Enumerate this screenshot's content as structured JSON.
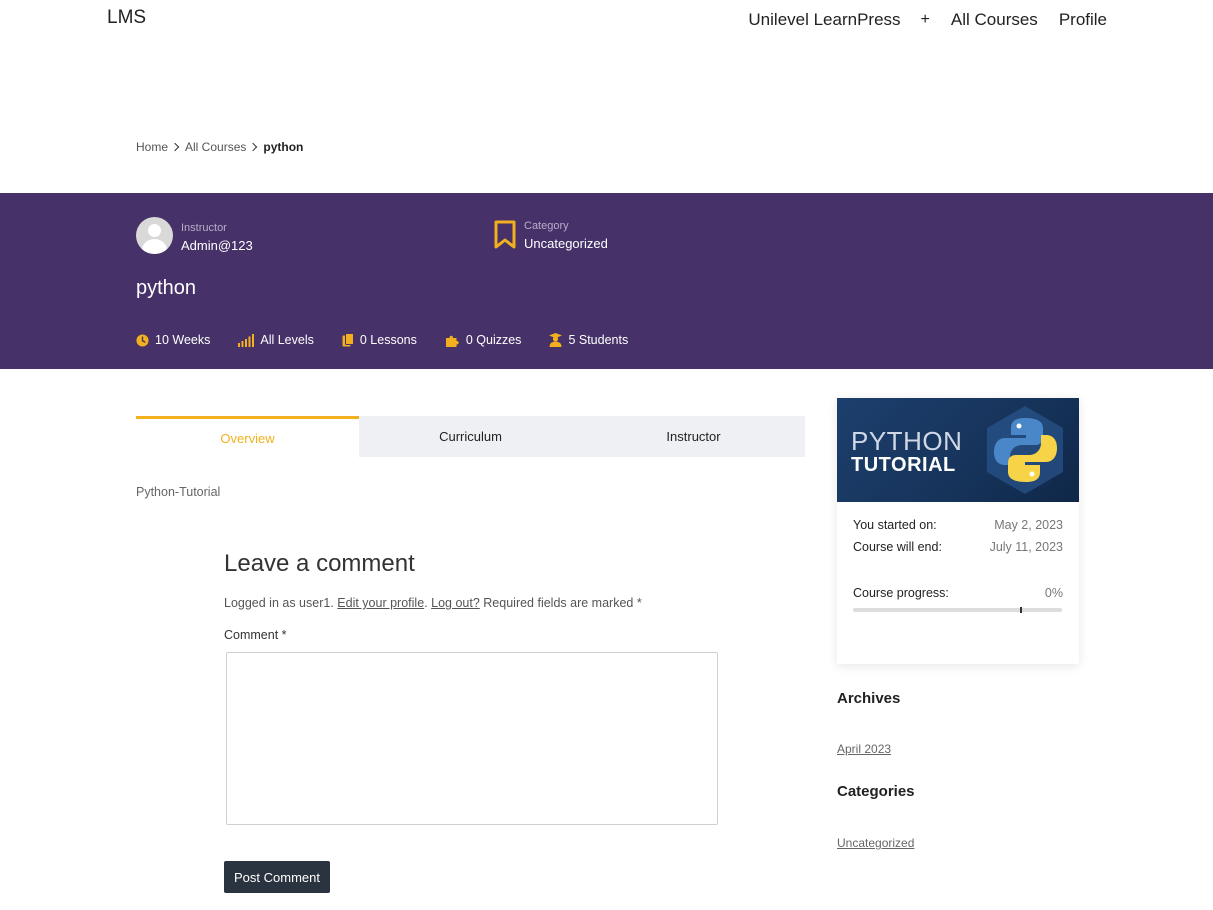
{
  "header": {
    "logo": "LMS",
    "nav": {
      "item1": "Unilevel LearnPress",
      "plus": "+",
      "item2": "All Courses",
      "item3": "Profile"
    }
  },
  "breadcrumb": {
    "home": "Home",
    "all_courses": "All Courses",
    "current": "python"
  },
  "banner": {
    "instructor_label": "Instructor",
    "instructor_name": "Admin@123",
    "category_label": "Category",
    "category_value": "Uncategorized",
    "course_title": "python",
    "stats": {
      "duration": "10 Weeks",
      "level": "All Levels",
      "lessons": "0 Lessons",
      "quizzes": "0 Quizzes",
      "students": "5 Students"
    },
    "accent_color": "#f2b01e",
    "background_color": "#463168"
  },
  "tabs": {
    "overview": "Overview",
    "curriculum": "Curriculum",
    "instructor": "Instructor"
  },
  "overview_text": "Python-Tutorial",
  "comment": {
    "title": "Leave a comment",
    "logged_prefix": "Logged in as user1.",
    "edit_profile": "Edit your profile",
    "dot": ".",
    "log_out": "Log out?",
    "required_note": "Required fields are marked *",
    "label": "Comment *",
    "placeholder": "",
    "submit": "Post Comment"
  },
  "course_card": {
    "thumb_line1": "PYTHON",
    "thumb_line2": "TUTORIAL",
    "started_label": "You started on:",
    "started_value": "May 2, 2023",
    "end_label": "Course will end:",
    "end_value": "July 11, 2023",
    "progress_label": "Course progress:",
    "progress_value": "0%",
    "progress_fraction": 0
  },
  "sidebar": {
    "archives_title": "Archives",
    "archives_link": "April 2023",
    "categories_title": "Categories",
    "categories_link": "Uncategorized"
  },
  "icons": {
    "duration": "clock-icon",
    "level": "signal-bars-icon",
    "lessons": "copy-icon",
    "quizzes": "puzzle-icon",
    "students": "student-icon",
    "category": "bookmark-icon"
  }
}
